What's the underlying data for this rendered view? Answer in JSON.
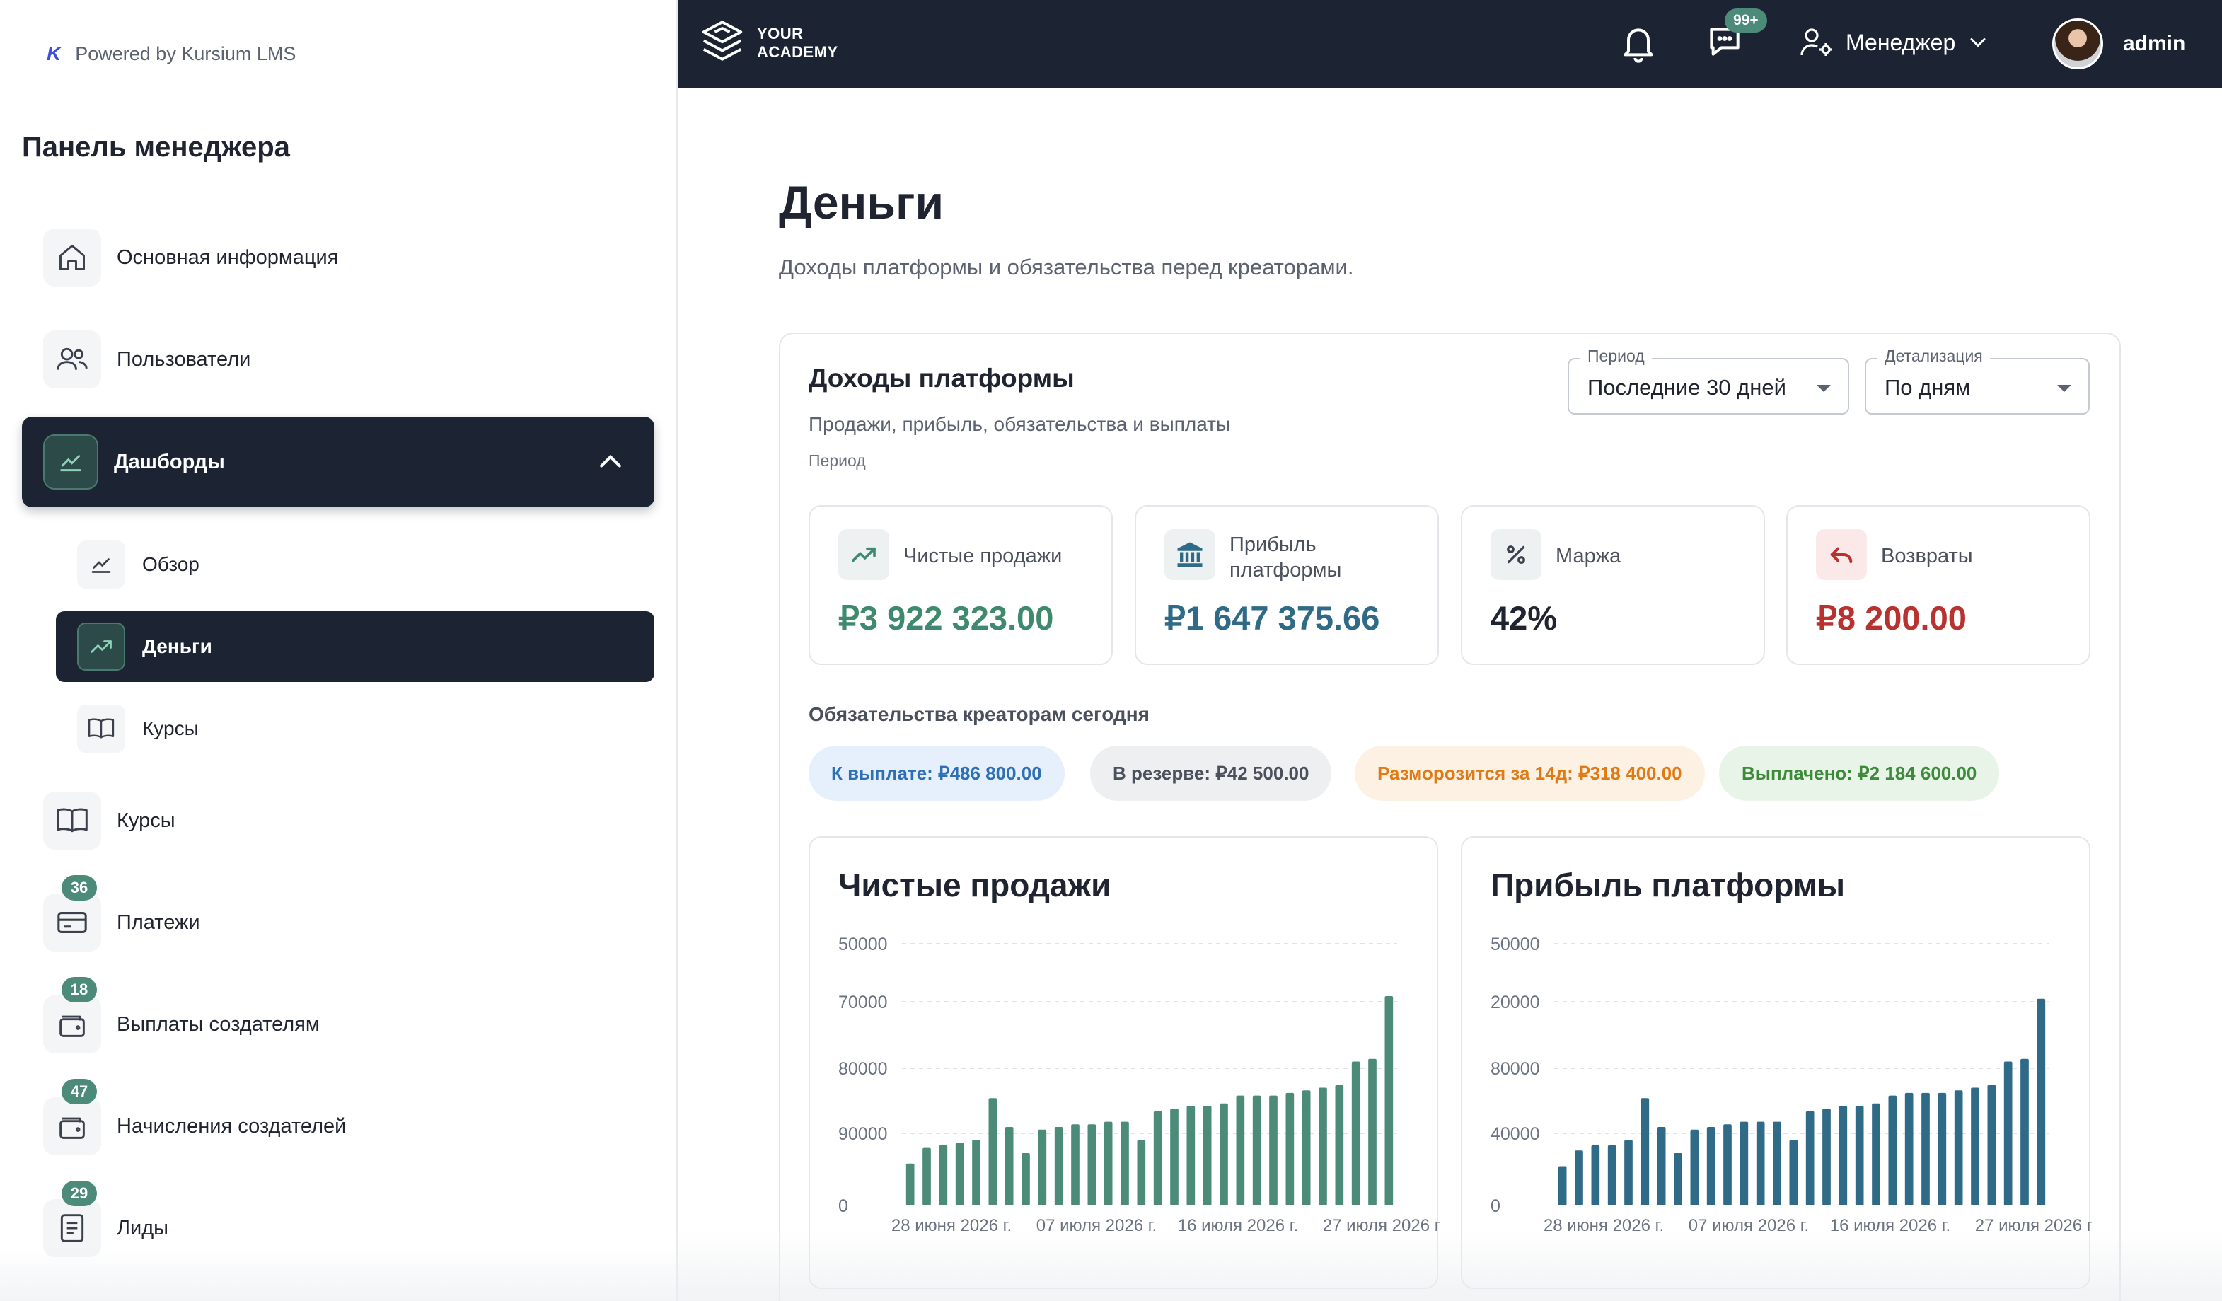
{
  "sidebar": {
    "powered_by": "Powered by Kursium LMS",
    "title": "Панель менеджера",
    "items": [
      {
        "label": "Основная информация",
        "icon": "home-icon"
      },
      {
        "label": "Пользователи",
        "icon": "users-icon"
      },
      {
        "label": "Дашборды",
        "icon": "chart-line-icon",
        "active": true,
        "expanded": true
      },
      {
        "label": "Курсы",
        "icon": "book-icon"
      },
      {
        "label": "Платежи",
        "icon": "credit-card-icon",
        "badge": "36"
      },
      {
        "label": "Выплаты создателям",
        "icon": "wallet-icon",
        "badge": "18"
      },
      {
        "label": "Начисления создателей",
        "icon": "wallet-icon",
        "badge": "47"
      },
      {
        "label": "Лиды",
        "icon": "document-icon",
        "badge": "29"
      }
    ],
    "sub_items": [
      {
        "label": "Обзор",
        "icon": "chart-line-icon"
      },
      {
        "label": "Деньги",
        "icon": "trending-up-icon",
        "active": true
      },
      {
        "label": "Курсы",
        "icon": "book-icon"
      }
    ]
  },
  "topbar": {
    "logo_line1": "YOUR",
    "logo_line2": "ACADEMY",
    "messages_badge": "99+",
    "role": "Менеджер",
    "username": "admin"
  },
  "main": {
    "title": "Деньги",
    "subtitle": "Доходы платформы и обязательства перед креаторами.",
    "card": {
      "title": "Доходы платформы",
      "subtitle": "Продажи, прибыль, обязательства и выплаты",
      "period_caption": "Период",
      "period_select": {
        "label": "Период",
        "value": "Последние 30 дней"
      },
      "detail_select": {
        "label": "Детализация",
        "value": "По дням"
      },
      "kpis": [
        {
          "label": "Чистые продажи",
          "value": "₽3 922 323.00",
          "color": "#3f8a6e",
          "icon": "trending-up-icon",
          "icon_bg": "#eef1f2"
        },
        {
          "label": "Прибыль платформы",
          "value": "₽1 647 375.66",
          "color": "#2f6a86",
          "icon": "bank-icon",
          "icon_bg": "#eef1f2"
        },
        {
          "label": "Маржа",
          "value": "42%",
          "color": "#1f2430",
          "icon": "percent-icon",
          "icon_bg": "#eef1f2"
        },
        {
          "label": "Возвраты",
          "value": "₽8 200.00",
          "color": "#b8322f",
          "icon": "undo-icon",
          "icon_bg": "#fbe9e9"
        }
      ],
      "obligations_title": "Обязательства креаторам сегодня",
      "pills": [
        {
          "text": "К выплате: ₽486 800.00",
          "color": "#2f6fb4",
          "bg": "#e6f0fc"
        },
        {
          "text": "В резерве: ₽42 500.00",
          "color": "#4a505c",
          "bg": "#eeeff1"
        },
        {
          "text": "Разморозится за 14д: ₽318 400.00",
          "color": "#e07a14",
          "bg": "#fdf1e4"
        },
        {
          "text": "Выплачено: ₽2 184 600.00",
          "color": "#3d8a3a",
          "bg": "#e8f4e8"
        }
      ]
    }
  },
  "chart_data": [
    {
      "type": "bar",
      "title": "Чистые продажи",
      "color": "#4c8b78",
      "y_tick_labels": [
        "50000",
        "70000",
        "80000",
        "90000",
        "0"
      ],
      "x_tick_labels": [
        "28 июня 2026 г.",
        "07 июля 2026 г.",
        "16 июля 2026 г.",
        "27 июля 2026 г."
      ],
      "values": [
        0.16,
        0.22,
        0.23,
        0.24,
        0.25,
        0.41,
        0.3,
        0.2,
        0.29,
        0.3,
        0.31,
        0.31,
        0.32,
        0.32,
        0.25,
        0.36,
        0.37,
        0.38,
        0.38,
        0.39,
        0.42,
        0.42,
        0.42,
        0.43,
        0.44,
        0.45,
        0.46,
        0.55,
        0.56,
        0.8
      ]
    },
    {
      "type": "bar",
      "title": "Прибыль платформы",
      "color": "#2f6a86",
      "y_tick_labels": [
        "50000",
        "20000",
        "80000",
        "40000",
        "0"
      ],
      "x_tick_labels": [
        "28 июня 2026 г.",
        "07 июля 2026 г.",
        "16 июля 2026 г.",
        "27 июля 2026 г."
      ],
      "values": [
        0.15,
        0.21,
        0.23,
        0.23,
        0.25,
        0.41,
        0.3,
        0.2,
        0.29,
        0.3,
        0.31,
        0.32,
        0.32,
        0.32,
        0.25,
        0.36,
        0.37,
        0.38,
        0.38,
        0.39,
        0.42,
        0.43,
        0.43,
        0.43,
        0.44,
        0.45,
        0.46,
        0.55,
        0.56,
        0.79
      ]
    }
  ]
}
